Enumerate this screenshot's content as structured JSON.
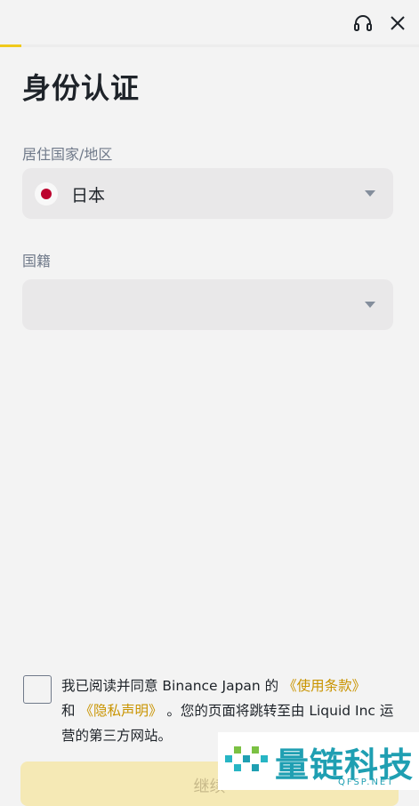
{
  "header": {
    "support_icon": "headset-icon",
    "close_icon": "close-icon",
    "progress": 0.05,
    "accent_color": "#F0C91B"
  },
  "page": {
    "title": "身份认证"
  },
  "form": {
    "residence": {
      "label": "居住国家/地区",
      "value": "日本",
      "flag": "japan-flag-icon"
    },
    "nationality": {
      "label": "国籍",
      "value": ""
    }
  },
  "agreement": {
    "text_1": "我已阅读并同意 Binance Japan 的",
    "link_terms": "《使用条款》",
    "text_2": "和",
    "link_privacy": "《隐私声明》",
    "text_3": "。您的页面将跳转至由 Liquid Inc 运营的第三方网站。",
    "checked": false
  },
  "footer": {
    "continue_label": "继续"
  },
  "watermark": {
    "text": "量链科技",
    "sub": "QFSP.NET"
  }
}
